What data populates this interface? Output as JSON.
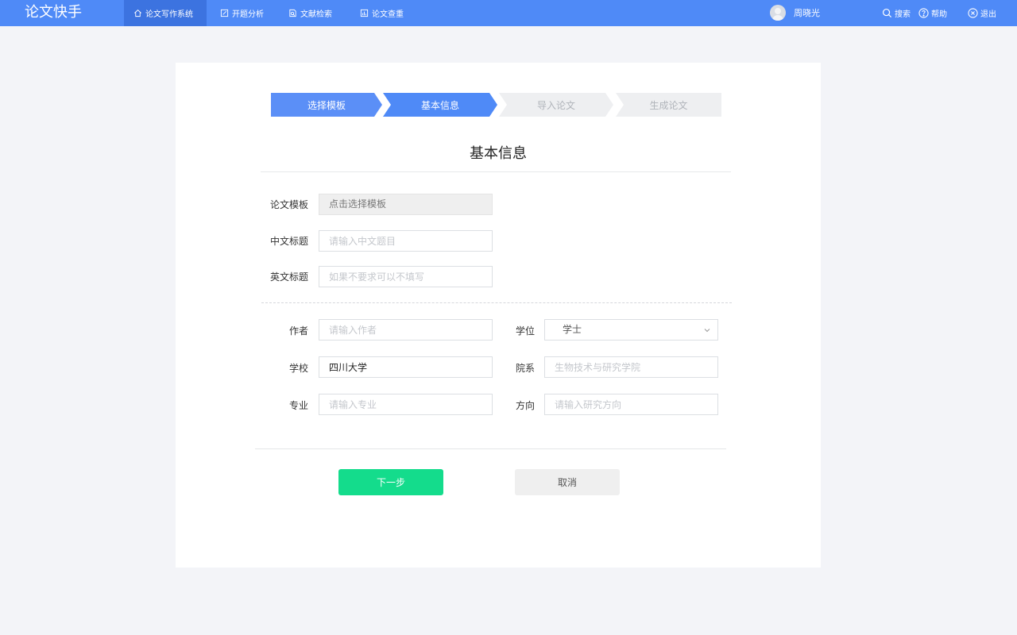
{
  "app": {
    "title": "论文快手"
  },
  "nav": {
    "items": [
      {
        "label": "论文写作系统",
        "icon": "home-icon",
        "active": true
      },
      {
        "label": "开题分析",
        "icon": "edit-icon",
        "active": false
      },
      {
        "label": "文献检索",
        "icon": "document-search-icon",
        "active": false
      },
      {
        "label": "论文查重",
        "icon": "chart-icon",
        "active": false
      }
    ]
  },
  "user": {
    "name": "周晓光",
    "avatar": "avatar-icon"
  },
  "actions": {
    "search": "搜索",
    "help": "帮助",
    "logout": "退出"
  },
  "steps": [
    {
      "label": "选择模板",
      "state": "done"
    },
    {
      "label": "基本信息",
      "state": "current"
    },
    {
      "label": "导入论文",
      "state": "todo"
    },
    {
      "label": "生成论文",
      "state": "todo"
    }
  ],
  "colors": {
    "accent": "#4f8af7",
    "primary_button": "#14dc8c",
    "step_todo": "#eeeff1"
  },
  "form": {
    "title": "基本信息",
    "template": {
      "label": "论文模板",
      "value": "点击选择模板"
    },
    "cn_title": {
      "label": "中文标题",
      "placeholder": "请输入中文题目"
    },
    "en_title": {
      "label": "英文标题",
      "placeholder": "如果不要求可以不填写"
    },
    "author": {
      "label": "作者",
      "placeholder": "请输入作者"
    },
    "degree": {
      "label": "学位",
      "value": "学士"
    },
    "school": {
      "label": "学校",
      "value": "四川大学"
    },
    "department": {
      "label": "院系",
      "placeholder": "生物技术与研究学院"
    },
    "major": {
      "label": "专业",
      "placeholder": "请输入专业"
    },
    "direction": {
      "label": "方向",
      "placeholder": "请输入研究方向"
    }
  },
  "buttons": {
    "next": "下一步",
    "cancel": "取消"
  }
}
